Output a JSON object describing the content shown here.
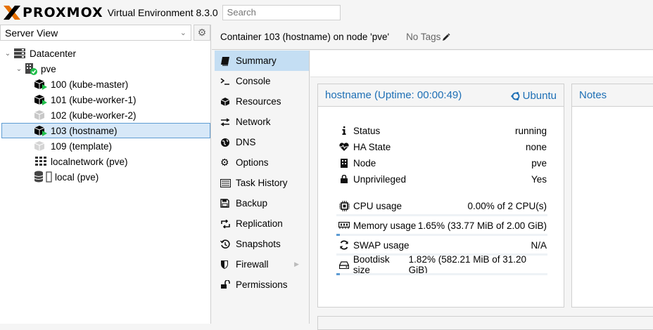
{
  "topbar": {
    "logo_text": "PROXMOX",
    "product": "Virtual Environment 8.3.0",
    "search_placeholder": "Search"
  },
  "left": {
    "view_selected": "Server View",
    "tree": [
      {
        "label": "Datacenter",
        "icon": "datacenter-icon"
      },
      {
        "label": "pve",
        "icon": "node-icon"
      },
      {
        "label": "100 (kube-master)",
        "icon": "container-running-icon"
      },
      {
        "label": "101 (kube-worker-1)",
        "icon": "container-running-icon"
      },
      {
        "label": "102 (kube-worker-2)",
        "icon": "container-stopped-icon"
      },
      {
        "label": "103 (hostname)",
        "icon": "container-running-icon"
      },
      {
        "label": "109 (template)",
        "icon": "container-template-icon"
      },
      {
        "label": "localnetwork (pve)",
        "icon": "sdn-zone-icon"
      },
      {
        "label": "local (pve)",
        "icon": "storage-icon"
      }
    ]
  },
  "header": {
    "title": "Container 103 (hostname) on node 'pve'",
    "tags": "No Tags"
  },
  "menu": {
    "items": [
      {
        "label": "Summary",
        "icon": "book-icon"
      },
      {
        "label": "Console",
        "icon": "terminal-icon"
      },
      {
        "label": "Resources",
        "icon": "cube-icon"
      },
      {
        "label": "Network",
        "icon": "exchange-icon"
      },
      {
        "label": "DNS",
        "icon": "globe-icon"
      },
      {
        "label": "Options",
        "icon": "gear-icon"
      },
      {
        "label": "Task History",
        "icon": "list-icon"
      },
      {
        "label": "Backup",
        "icon": "floppy-icon"
      },
      {
        "label": "Replication",
        "icon": "retweet-icon"
      },
      {
        "label": "Snapshots",
        "icon": "history-icon"
      },
      {
        "label": "Firewall",
        "icon": "shield-icon"
      },
      {
        "label": "Permissions",
        "icon": "unlock-icon"
      }
    ]
  },
  "status_panel": {
    "title": "hostname (Uptime: 00:00:49)",
    "os": "Ubuntu",
    "rows": [
      {
        "label": "Status",
        "value": "running"
      },
      {
        "label": "HA State",
        "value": "none"
      },
      {
        "label": "Node",
        "value": "pve"
      },
      {
        "label": "Unprivileged",
        "value": "Yes"
      },
      {
        "label": "CPU usage",
        "value": "0.00% of 2 CPU(s)"
      },
      {
        "label": "Memory usage",
        "value": "1.65% (33.77 MiB of 2.00 GiB)"
      },
      {
        "label": "SWAP usage",
        "value": "N/A"
      },
      {
        "label": "Bootdisk size",
        "value": "1.82% (582.21 MiB of 31.20 GiB)"
      }
    ],
    "usage": {
      "cpu": 0.0,
      "memory": 1.65,
      "swap": 0,
      "bootdisk": 1.82
    }
  },
  "notes_panel": {
    "title": "Notes"
  },
  "colors": {
    "accent": "#1d6fb5",
    "selected_bg": "#c4def3",
    "running": "#21bf4b",
    "logo_orange": "#e57000"
  }
}
